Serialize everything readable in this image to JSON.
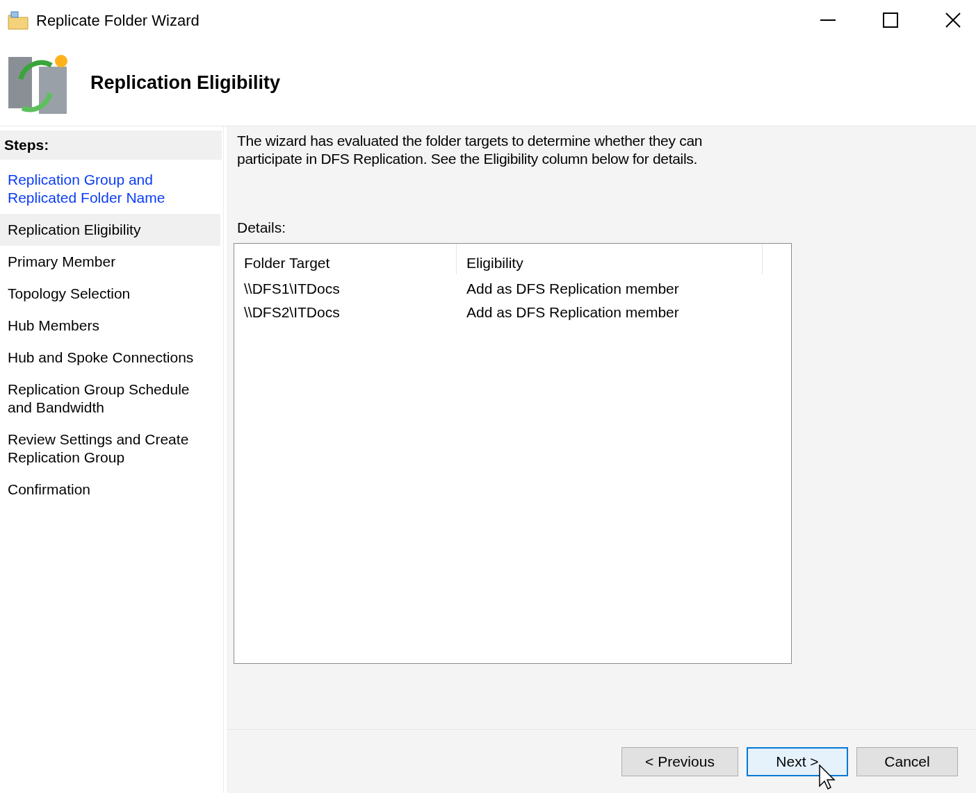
{
  "window": {
    "title": "Replicate Folder Wizard"
  },
  "header": {
    "title": "Replication Eligibility"
  },
  "steps": {
    "heading": "Steps:",
    "items": [
      {
        "label": "Replication Group and\nReplicated Folder Name",
        "completed": true,
        "selected": false
      },
      {
        "label": "Replication Eligibility",
        "completed": false,
        "selected": true
      },
      {
        "label": "Primary Member",
        "completed": false,
        "selected": false
      },
      {
        "label": "Topology Selection",
        "completed": false,
        "selected": false
      },
      {
        "label": "Hub Members",
        "completed": false,
        "selected": false
      },
      {
        "label": "Hub and Spoke Connections",
        "completed": false,
        "selected": false
      },
      {
        "label": "Replication Group Schedule\nand Bandwidth",
        "completed": false,
        "selected": false
      },
      {
        "label": "Review Settings and Create\nReplication Group",
        "completed": false,
        "selected": false
      },
      {
        "label": "Confirmation",
        "completed": false,
        "selected": false
      }
    ]
  },
  "description": "The wizard has evaluated the folder targets to determine whether they can\nparticipate in DFS Replication. See the Eligibility column below for details.",
  "details": {
    "label": "Details:",
    "columns": [
      "Folder Target",
      "Eligibility"
    ],
    "rows": [
      [
        "\\\\DFS1\\ITDocs",
        "Add as DFS Replication member"
      ],
      [
        "\\\\DFS2\\ITDocs",
        "Add as DFS Replication member"
      ]
    ]
  },
  "buttons": [
    {
      "label": "< Previous",
      "focused": false
    },
    {
      "label": "Next >",
      "focused": true
    },
    {
      "label": "Cancel",
      "focused": false
    }
  ]
}
